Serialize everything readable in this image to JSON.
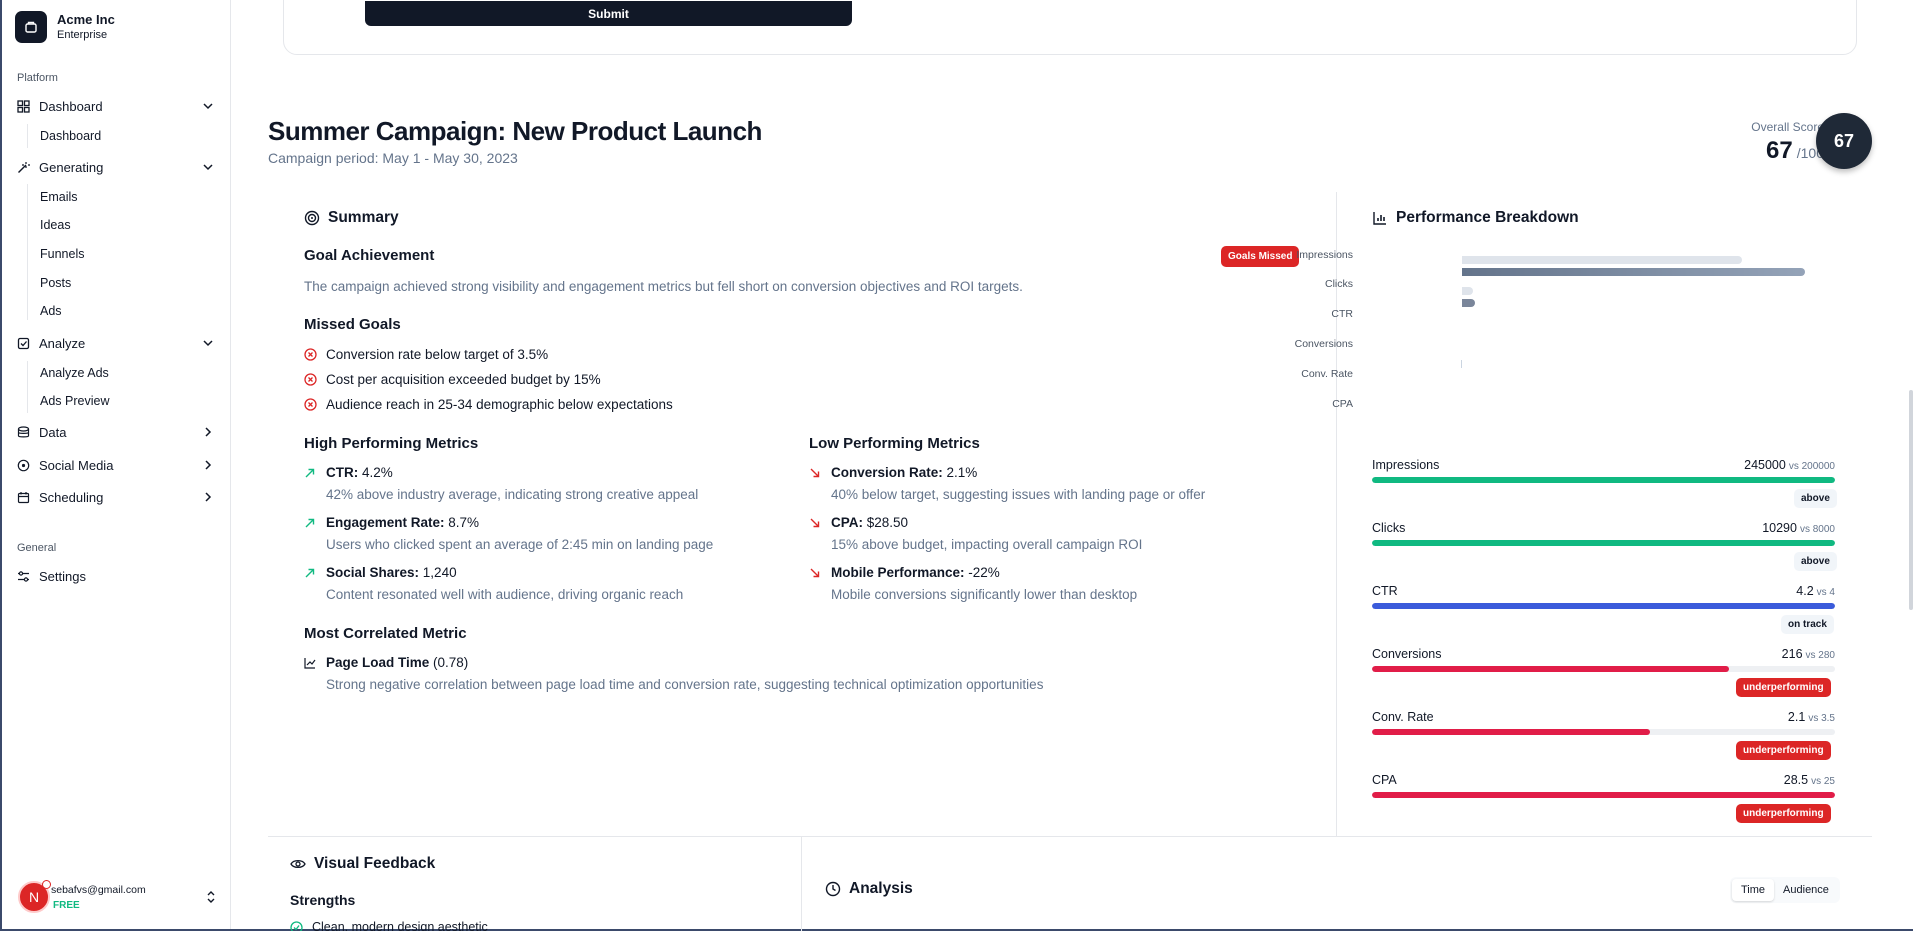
{
  "brand": {
    "name": "Acme Inc",
    "plan": "Enterprise"
  },
  "sidebar": {
    "platform_label": "Platform",
    "general_label": "General",
    "groups": [
      {
        "label": "Dashboard",
        "icon": "dashboard-icon",
        "expanded": true,
        "items": [
          "Dashboard"
        ]
      },
      {
        "label": "Generating",
        "icon": "wand-icon",
        "expanded": true,
        "items": [
          "Emails",
          "Ideas",
          "Funnels",
          "Posts",
          "Ads"
        ]
      },
      {
        "label": "Analyze",
        "icon": "clipboard-icon",
        "expanded": true,
        "items": [
          "Analyze Ads",
          "Ads Preview"
        ]
      },
      {
        "label": "Data",
        "icon": "database-icon",
        "expanded": false
      },
      {
        "label": "Social Media",
        "icon": "globe-icon",
        "expanded": false
      },
      {
        "label": "Scheduling",
        "icon": "calendar-icon",
        "expanded": false
      }
    ],
    "settings": "Settings",
    "user": {
      "initial": "N",
      "email": "sebafvs@gmail.com",
      "plan": "FREE"
    }
  },
  "form": {
    "submit_label": "Submit"
  },
  "campaign": {
    "title": "Summer Campaign: New Product Launch",
    "period": "Campaign period: May 1 - May 30, 2023",
    "score_label": "Overall Score",
    "score": "67",
    "score_of": "/100"
  },
  "summary": {
    "heading": "Summary",
    "goal_title": "Goal Achievement",
    "goal_badge": "Goals Missed",
    "goal_text": "The campaign achieved strong visibility and engagement metrics but fell short on conversion objectives and ROI targets.",
    "missed_title": "Missed Goals",
    "missed": [
      "Conversion rate below target of 3.5%",
      "Cost per acquisition exceeded budget by 15%",
      "Audience reach in 25-34 demographic below expectations"
    ],
    "high_title": "High Performing Metrics",
    "high": [
      {
        "name": "CTR:",
        "value": " 4.2%",
        "desc": "42% above industry average, indicating strong creative appeal"
      },
      {
        "name": "Engagement Rate:",
        "value": " 8.7%",
        "desc": "Users who clicked spent an average of 2:45 min on landing page"
      },
      {
        "name": "Social Shares:",
        "value": " 1,240",
        "desc": "Content resonated well with audience, driving organic reach"
      }
    ],
    "low_title": "Low Performing Metrics",
    "low": [
      {
        "name": "Conversion Rate:",
        "value": " 2.1%",
        "desc": "40% below target, suggesting issues with landing page or offer"
      },
      {
        "name": "CPA:",
        "value": " $28.50",
        "desc": "15% above budget, impacting overall campaign ROI"
      },
      {
        "name": "Mobile Performance:",
        "value": " -22%",
        "desc": "Mobile conversions significantly lower than desktop"
      }
    ],
    "corr_title": "Most Correlated Metric",
    "corr_name": "Page Load Time",
    "corr_value": " (0.78)",
    "corr_desc": "Strong negative correlation between page load time and conversion rate, suggesting technical optimization opportunities"
  },
  "performance": {
    "heading": "Performance Breakdown",
    "chart_labels": [
      "Impressions",
      "Clicks",
      "CTR",
      "Conversions",
      "Conv. Rate",
      "CPA"
    ],
    "metrics": [
      {
        "name": "Impressions",
        "value": "245000",
        "vs": "vs 200000",
        "status": "above",
        "fill_pct": 100,
        "color": "#10b981"
      },
      {
        "name": "Clicks",
        "value": "10290",
        "vs": "vs 8000",
        "status": "above",
        "fill_pct": 100,
        "color": "#10b981"
      },
      {
        "name": "CTR",
        "value": "4.2",
        "vs": "vs 4",
        "status": "on track",
        "fill_pct": 100,
        "color": "#3b5bdb"
      },
      {
        "name": "Conversions",
        "value": "216",
        "vs": "vs 280",
        "status": "underperforming",
        "fill_pct": 77,
        "color": "#e11d48"
      },
      {
        "name": "Conv. Rate",
        "value": "2.1",
        "vs": "vs 3.5",
        "status": "underperforming",
        "fill_pct": 60,
        "color": "#e11d48"
      },
      {
        "name": "CPA",
        "value": "28.5",
        "vs": "vs 25",
        "status": "underperforming",
        "fill_pct": 100,
        "color": "#e11d48"
      }
    ]
  },
  "visual_feedback": {
    "heading": "Visual Feedback",
    "strengths": "Strengths",
    "first_item": "Clean, modern design aesthetic"
  },
  "analysis": {
    "heading": "Analysis",
    "toggle": [
      "Time",
      "Audience"
    ]
  }
}
